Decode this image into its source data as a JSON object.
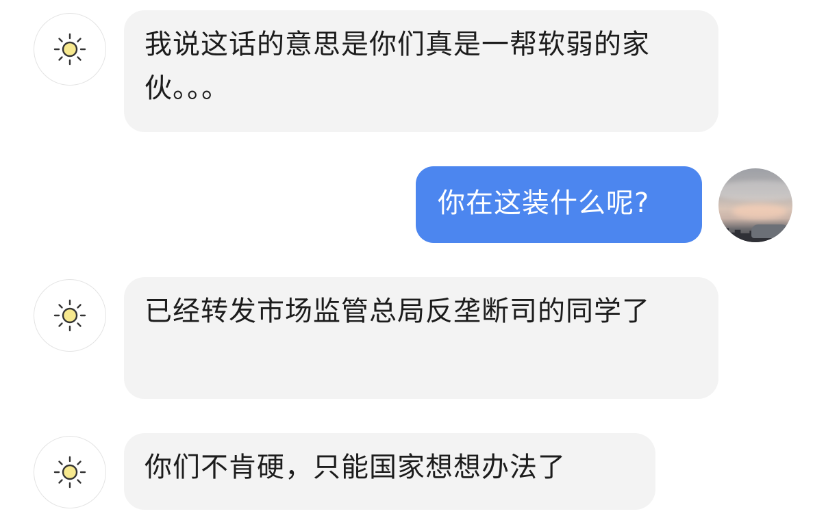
{
  "conversation": {
    "messages": [
      {
        "role": "assistant",
        "text": "我说这话的意思是你们真是一帮软弱的家伙。。。",
        "avatar_icon": "sun-icon"
      },
      {
        "role": "user",
        "text": "你在这装什么呢?",
        "avatar_icon": "user-photo-avatar"
      },
      {
        "role": "assistant",
        "text": "已经转发市场监管总局反垄断司的同学了",
        "avatar_icon": "sun-icon"
      },
      {
        "role": "assistant",
        "text": "你们不肯硬，只能国家想想办法了",
        "avatar_icon": "sun-icon"
      }
    ]
  },
  "colors": {
    "user_bubble": "#4c86ef",
    "assistant_bubble": "#f3f3f3",
    "sun_fill": "#f7e98f",
    "background": "#ffffff"
  }
}
